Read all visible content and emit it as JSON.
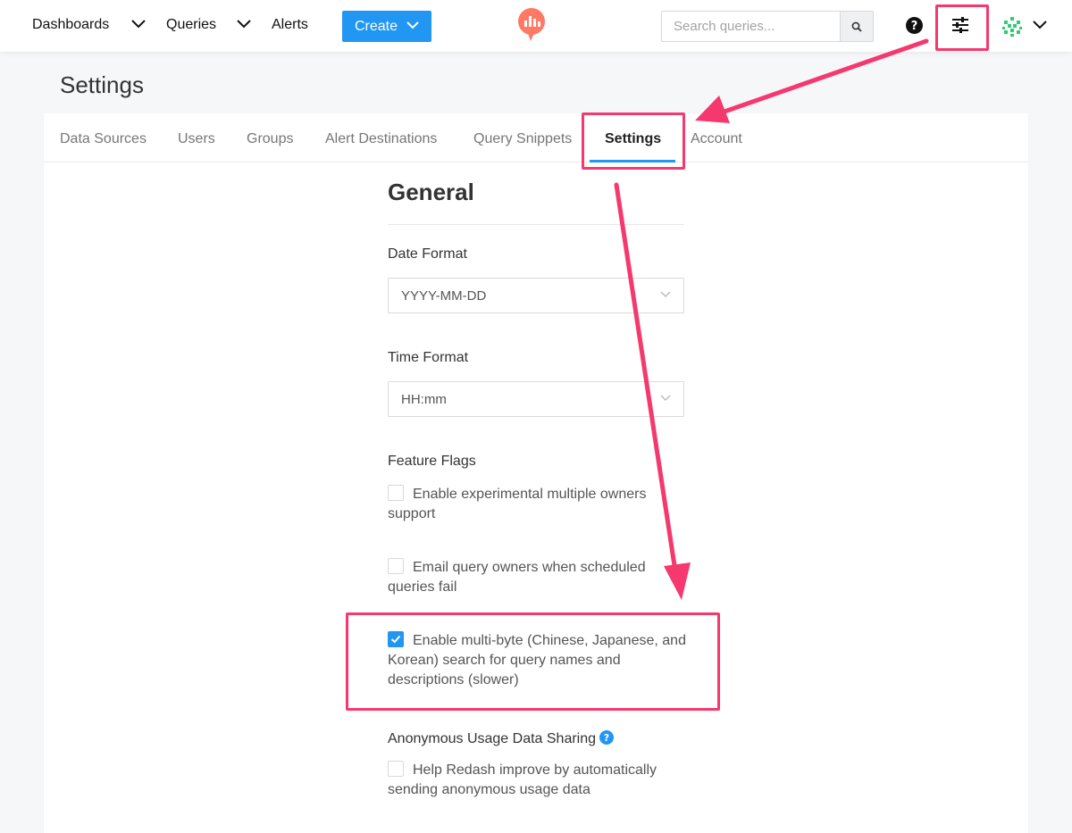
{
  "nav": {
    "dashboards": "Dashboards",
    "queries": "Queries",
    "alerts": "Alerts",
    "create": "Create",
    "search_placeholder": "Search queries..."
  },
  "page": {
    "title": "Settings"
  },
  "tabs": [
    {
      "label": "Data Sources"
    },
    {
      "label": "Users"
    },
    {
      "label": "Groups"
    },
    {
      "label": "Alert Destinations"
    },
    {
      "label": "Query Snippets"
    },
    {
      "label": "Settings"
    },
    {
      "label": "Account"
    }
  ],
  "general": {
    "title": "General",
    "date_format_label": "Date Format",
    "date_format_value": "YYYY-MM-DD",
    "time_format_label": "Time Format",
    "time_format_value": "HH:mm",
    "feature_flags_label": "Feature Flags",
    "flags": [
      {
        "label": "Enable experimental multiple owners support",
        "checked": false
      },
      {
        "label": "Email query owners when scheduled queries fail",
        "checked": false
      },
      {
        "label": "Enable multi-byte (Chinese, Japanese, and Korean) search for query names and descriptions (slower)",
        "checked": true
      }
    ],
    "usage_label": "Anonymous Usage Data Sharing",
    "usage_checkbox": {
      "label": "Help Redash improve by automatically sending anonymous usage data",
      "checked": false
    }
  },
  "colors": {
    "accent": "#2196f3",
    "highlight": "#f5386e",
    "logo": "#ff7964"
  },
  "icons": [
    "chevron-down-icon",
    "redash-logo",
    "search-icon",
    "help-icon",
    "sliders-icon",
    "avatar",
    "check-icon",
    "info-icon"
  ]
}
